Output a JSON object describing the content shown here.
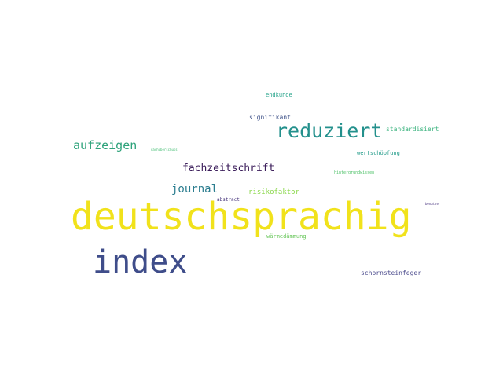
{
  "word_cloud": {
    "background": "#ffffff",
    "words": [
      {
        "text": "deutschsprachig",
        "color": "#f1e21b"
      },
      {
        "text": "index",
        "color": "#3f4d8a"
      },
      {
        "text": "reduziert",
        "color": "#23908c"
      },
      {
        "text": "aufzeigen",
        "color": "#2ea37b"
      },
      {
        "text": "fachzeitschrift",
        "color": "#3b1d5a"
      },
      {
        "text": "journal",
        "color": "#2b7d8f"
      },
      {
        "text": "risikofaktor",
        "color": "#8ad74a"
      },
      {
        "text": "signifikant",
        "color": "#3e5188"
      },
      {
        "text": "endkunde",
        "color": "#25a38a"
      },
      {
        "text": "standardisiert",
        "color": "#39b27d"
      },
      {
        "text": "wertschöpfung",
        "color": "#1f9a88"
      },
      {
        "text": "hintergrundwissen",
        "color": "#4ec168"
      },
      {
        "text": "abstract",
        "color": "#45327a"
      },
      {
        "text": "wärmedämmung",
        "color": "#66c658"
      },
      {
        "text": "schornsteinfeger",
        "color": "#4a4a8c"
      },
      {
        "text": "dachüberschuss",
        "color": "#3dbb6e"
      },
      {
        "text": "benutzer",
        "color": "#46327e"
      }
    ]
  }
}
